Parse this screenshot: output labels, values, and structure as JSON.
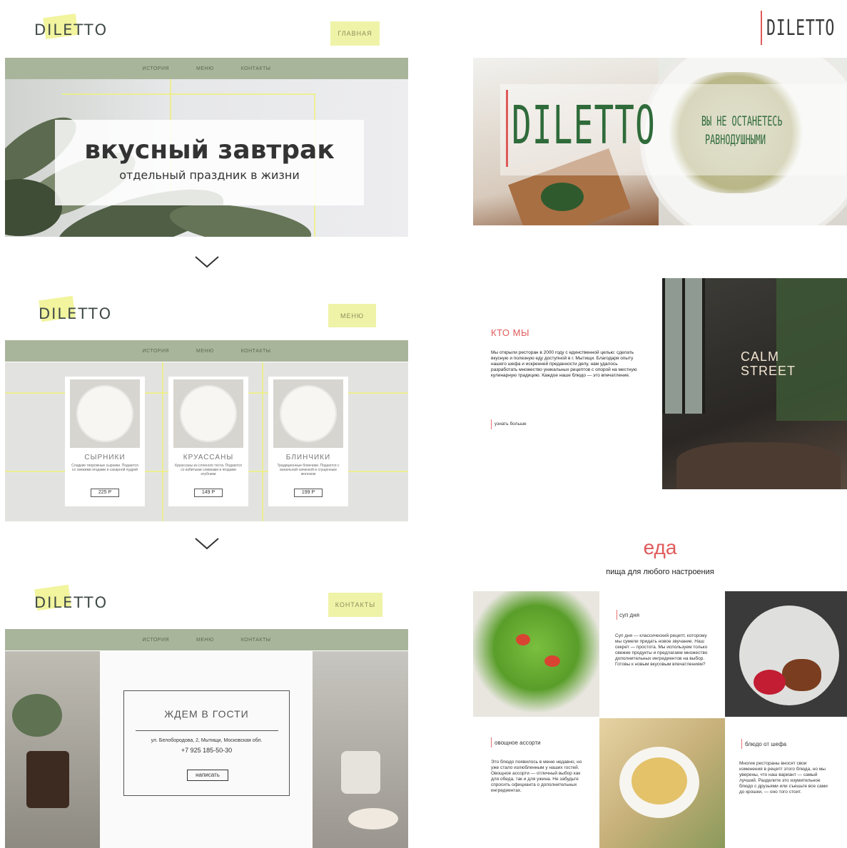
{
  "brand": "DILETTO",
  "nav": {
    "history": "ИСТОРИЯ",
    "menu": "МЕНЮ",
    "contacts": "КОНТАКТЫ"
  },
  "section1": {
    "button": "ГЛАВНАЯ",
    "nav": {
      "history": "ИСТОРИЯ",
      "menu": "МЕНЮ",
      "contacts": "КОНТАКТЫ"
    },
    "headline": "вкусный завтрак",
    "subheadline": "отдельный праздник в жизни"
  },
  "section2": {
    "button": "МЕНЮ",
    "nav": {
      "history": "ИСТОРИЯ",
      "menu": "МЕНЮ",
      "contacts": "КОНТАКТЫ"
    },
    "cards": [
      {
        "name": "СЫРНИКИ",
        "desc": "Сладкие творожные сырники. Подаются со свежими ягодами и сахарной пудрой",
        "price": "225 Р"
      },
      {
        "name": "КРУАССАНЫ",
        "desc": "Круассаны из слоеного теста. Подаются со взбитыми сливками и ягодами клубники",
        "price": "149 Р"
      },
      {
        "name": "БЛИНЧИКИ",
        "desc": "Традиционные блинчики. Подаются с ванильной начинкой и сгущенным молоком",
        "price": "199 Р"
      }
    ]
  },
  "section3": {
    "button": "КОНТАКТЫ",
    "nav": {
      "history": "ИСТОРИЯ",
      "menu": "МЕНЮ",
      "contacts": "КОНТАКТЫ"
    },
    "heading": "ЖДЕМ В ГОСТИ",
    "address": "ул. Белобородова, 2, Мытищи, Московская обл.",
    "phone": "+7 925 185-50-30",
    "write_button": "написать"
  },
  "right": {
    "logo": "DILETTO",
    "hero_brand": "DILETTO",
    "tagline_line1": "ВЫ НЕ ОСТАНЕТЕСЬ",
    "tagline_line2": "РАВНОДУШНЫМИ",
    "about": {
      "title": "КТО МЫ",
      "text": "Мы открыли ресторан в 2000 году с единственной целью: сделать вкусную и полезную еду доступной в г. Мытищи. Благодаря опыту нашего шефа и искренней преданности делу, нам удалось разработать множество уникальных рецептов с опорой на местную кулинарную традицию. Каждое наше блюдо — это впечатление.",
      "link": "узнать больше",
      "sign": "CALM STREET"
    },
    "food": {
      "title": "еда",
      "subtitle": "пища для любого настроения",
      "soup": {
        "title": "суп дня",
        "text": "Суп дня — классический рецепт, которому мы сумели придать новое звучание. Наш секрет — простота. Мы используем только свежие продукты и предлагаем множество дополнительных ингредиентов на выбор. Готовы к новым вкусовым впечатлениям?"
      },
      "veg": {
        "title": "овощное ассорти",
        "text": "Это блюдо появилось в меню недавно, но уже стало излюбленным у наших гостей. Овощное ассорти — отличный выбор как для обеда, так и для ужина. Не забудьте спросить официанта о дополнительных ингредиентах."
      },
      "chef": {
        "title": "блюдо от шефа",
        "text": "Многие рестораны вносят свои изменения в рецепт этого блюда, но мы уверены, что наш вариант — самый лучший. Разделите это изумительное блюдо с друзьями или съешьте все сами до крошки, — оно того стоит."
      }
    }
  },
  "colors": {
    "accent_yellow": "#eef07e",
    "nav_green": "#a9b59b",
    "red_accent": "#e05a5a",
    "dark_green": "#2f6b3a"
  }
}
